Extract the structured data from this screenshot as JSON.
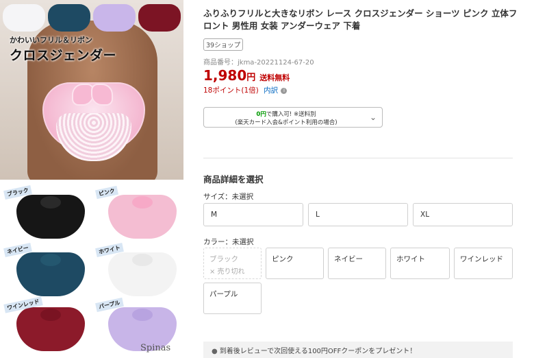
{
  "gallery": {
    "hero_caption_small": "かわいいフリル＆リボン",
    "hero_caption_big": "クロスジェンダー",
    "top_thumb_colors": [
      "#f5f5f7",
      "#1e4a63",
      "#c9b6ea",
      "#7c1424"
    ],
    "swatches": [
      {
        "label": "ブラック",
        "color": "#161616",
        "bow": "#2a2a2a"
      },
      {
        "label": "ピンク",
        "color": "#f4bdd2",
        "bow": "#f7a9c7"
      },
      {
        "label": "ネイビー",
        "color": "#1e4a63",
        "bow": "#24576f"
      },
      {
        "label": "ホワイト",
        "color": "#f3f3f3",
        "bow": "#e8e8e8"
      },
      {
        "label": "ワインレッド",
        "color": "#8c1a2a",
        "bow": "#7a1322"
      },
      {
        "label": "パープル",
        "color": "#c8b5e8",
        "bow": "#b8a3e0"
      }
    ],
    "watermark": "Spinas"
  },
  "product": {
    "title": "ふりふりフリルと大きなリボン レース クロスジェンダー ショーツ ピンク 立体フロント 男性用 女装 アンダーウェア 下着",
    "shop_badge": "39ショップ",
    "code": "商品番号：jkma-20221124-67-20",
    "price": "1,980",
    "price_unit": "円",
    "shipping": "送料無料",
    "points": "18ポイント(1倍)",
    "points_link": "内訳",
    "accent_color": "#bf0000"
  },
  "buy_box": {
    "zero_text": "0円",
    "line1_rest": "で購入可! ※送料別",
    "line2": "(楽天カード入会&ポイント利用の場合)"
  },
  "selection": {
    "heading": "商品詳細を選択",
    "size_label": "サイズ：未選択",
    "sizes": [
      "M",
      "L",
      "XL"
    ],
    "color_label": "カラー：未選択",
    "colors": [
      {
        "name": "ブラック",
        "note": "× 売り切れ"
      },
      {
        "name": "ピンク"
      },
      {
        "name": "ネイビー"
      },
      {
        "name": "ホワイト"
      },
      {
        "name": "ワインレッド"
      },
      {
        "name": "パープル"
      }
    ]
  },
  "coupon": {
    "text": "到着後レビューで次回使える100円OFFクーポンをプレゼント！"
  }
}
